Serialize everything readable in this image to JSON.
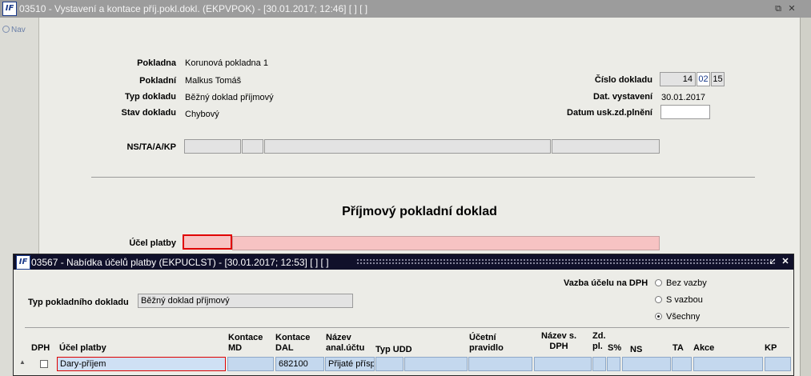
{
  "window": {
    "logo": "IF",
    "title": "03510 - Vystavení a kontace příj.pokl.dokl. (EKPVPOK) - [30.01.2017; 12:46]  [ ]  [ ]"
  },
  "nav": {
    "label": "Nav"
  },
  "form": {
    "pokladna_label": "Pokladna",
    "pokladna_value": "Korunová pokladna 1",
    "pokladni_label": "Pokladní",
    "pokladni_value": "Malkus Tomáš",
    "typ_label": "Typ dokladu",
    "typ_value": "Běžný doklad příjmový",
    "stav_label": "Stav dokladu",
    "stav_value": "Chybový",
    "cislo_label": "Číslo dokladu",
    "cislo_parts": [
      "14",
      "02",
      "15"
    ],
    "datvyst_label": "Dat. vystavení",
    "datvyst_value": "30.01.2017",
    "datusk_label": "Datum usk.zd.plnění",
    "datusk_value": "",
    "ns_label": "NS/TA/A/KP",
    "heading": "Příjmový pokladní doklad",
    "ucel_label": "Účel platby",
    "ucel_value": ""
  },
  "dialog": {
    "logo": "IF",
    "title": "03567 - Nabídka účelů platby (EKPUCLST) - [30.01.2017; 12:53]  [ ]  [ ]",
    "typ_label": "Typ pokladního dokladu",
    "typ_value": "Běžný doklad příjmový",
    "vazba_label": "Vazba účelu na DPH",
    "radios": [
      {
        "label": "Bez vazby",
        "selected": false
      },
      {
        "label": "S vazbou",
        "selected": false
      },
      {
        "label": "Všechny",
        "selected": true
      }
    ],
    "columns": {
      "dph": "DPH",
      "ucel": "Účel platby",
      "kmd": "Kontace\nMD",
      "kdal": "Kontace\nDAL",
      "nazev": "Název\nanal.účtu",
      "typudd": "Typ UDD",
      "ucetni": "Účetní\npravidlo",
      "nazevs": "Název s.\nDPH",
      "zdpl": "Zd.\npl.",
      "sp": "S%",
      "ns": "NS",
      "ta": "TA",
      "akce": "Akce",
      "kp": "KP"
    },
    "row": {
      "ucel": "Dary-příjem",
      "kmd": "",
      "kdal": "682100",
      "nazev": "Přijaté přísp"
    }
  }
}
